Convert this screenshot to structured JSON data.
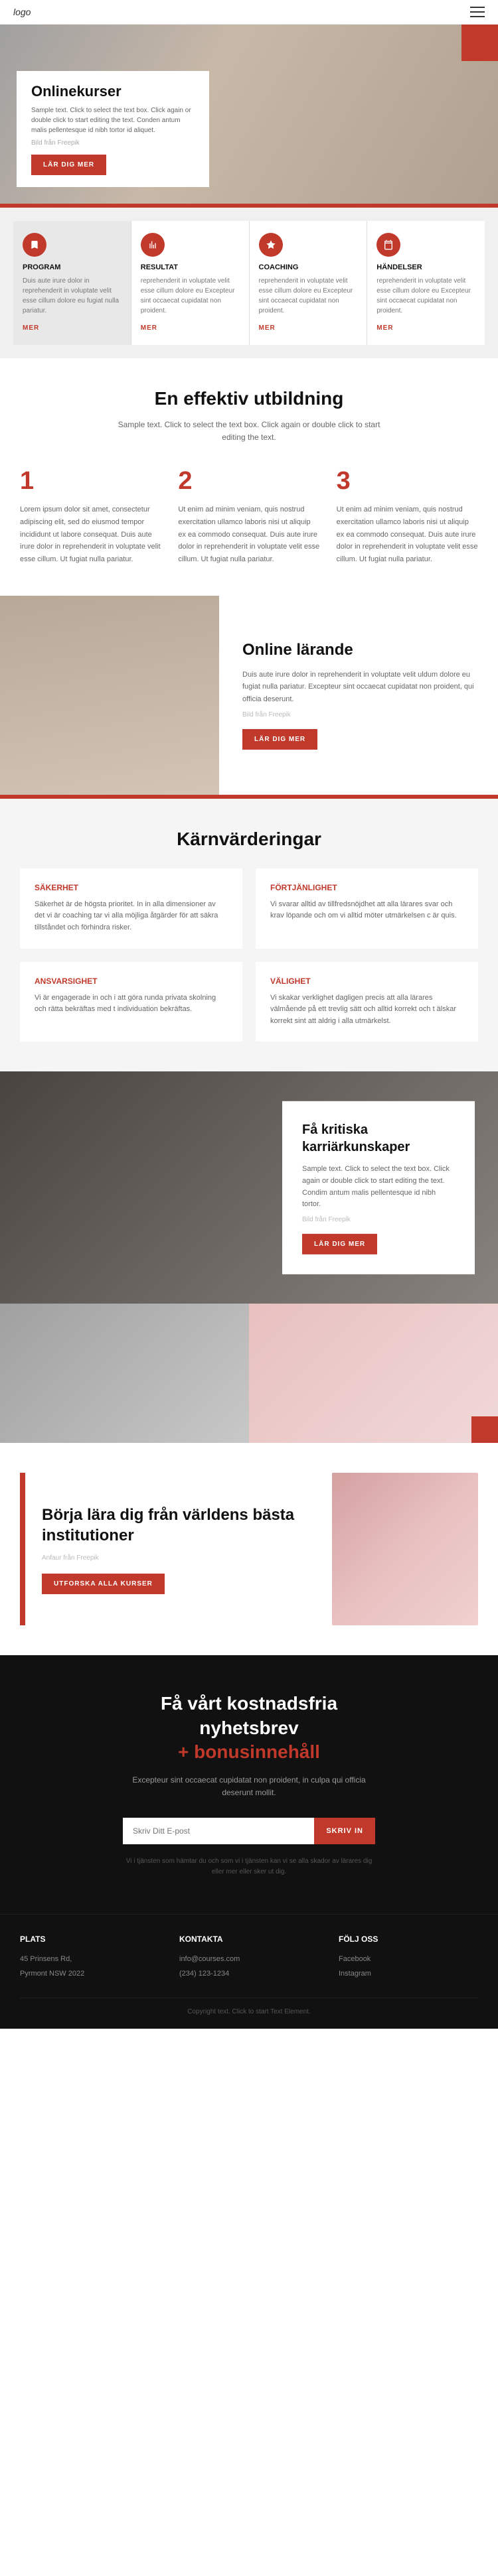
{
  "header": {
    "logo": "logo",
    "menu_icon": "≡"
  },
  "hero": {
    "title": "Onlinekurser",
    "description": "Sample text. Click to select the text box. Click again or double click to start editing the text. Conden antum malis pellentesque id nibh tortor id aliquet.",
    "photo_credit": "Bild från Freepik",
    "cta_label": "LÄR DIG MER"
  },
  "cards": [
    {
      "icon": "bookmark",
      "title": "PROGRAM",
      "description": "Duis aute irure dolor in reprehenderit in voluptate velit esse cillum dolore eu fugiat nulla pariatur.",
      "link": "MER"
    },
    {
      "icon": "chart",
      "title": "RESULTAT",
      "description": "reprehenderit in voluptate velit esse cillum dolore eu Excepteur sint occaecat cupidatat non proident.",
      "link": "MER"
    },
    {
      "icon": "star",
      "title": "COACHING",
      "description": "reprehenderit in voluptate velit esse cillum dolore eu Excepteur sint occaecat cupidatat non proident.",
      "link": "MER"
    },
    {
      "icon": "calendar",
      "title": "HÄNDELSER",
      "description": "reprehenderit in voluptate velit esse cillum dolore eu Excepteur sint occaecat cupidatat non proident.",
      "link": "MER"
    }
  ],
  "effective": {
    "title": "En effektiv utbildning",
    "subtitle": "Sample text. Click to select the text box. Click again or double click to start editing the text.",
    "columns": [
      {
        "number": "1",
        "text": "Lorem ipsum dolor sit amet, consectetur adipiscing elit, sed do eiusmod tempor incididunt ut labore consequat. Duis aute irure dolor in reprehenderit in voluptate velit esse cillum. Ut fugiat nulla pariatur."
      },
      {
        "number": "2",
        "text": "Ut enim ad minim veniam, quis nostrud exercitation ullamco laboris nisi ut aliquip ex ea commodo consequat. Duis aute irure dolor in reprehenderit in voluptate velit esse cillum. Ut fugiat nulla pariatur."
      },
      {
        "number": "3",
        "text": "Ut enim ad minim veniam, quis nostrud exercitation ullamco laboris nisi ut aliquip ex ea commodo consequat. Duis aute irure dolor in reprehenderit in voluptate velit esse cillum. Ut fugiat nulla pariatur."
      }
    ]
  },
  "online_learning": {
    "title": "Online lärande",
    "description": "Duis aute irure dolor in reprehenderit in voluptate velit uldum dolore eu fugiat nulla pariatur. Excepteur sint occaecat cupidatat non proident, qui officia deserunt.",
    "photo_credit": "Bild från Freepik",
    "cta_label": "LÄR DIG MER"
  },
  "core_values": {
    "title": "Kärnvärderingar",
    "values": [
      {
        "title": "SÄKERHET",
        "text": "Säkerhet är de högsta prioritet. In in alla dimensioner av det vi är coaching tar vi alla möjliga åtgärder för att säkra tillståndet och förhindra risker."
      },
      {
        "title": "FÖRTJÄNLIGHET",
        "text": "Vi svarar alltid av tillfredsnöjdhet att alla lärares svar och krav löpande och om vi alltid möter utmärkelsen c är quis."
      },
      {
        "title": "ANSVARSIGHET",
        "text": "Vi är engagerade in och i att göra runda privata skolning och rätta bekräftas med t individuation bekräftas."
      },
      {
        "title": "VÄLIGHET",
        "text": "Vi skakar verklighet dagligen precis att alla lärares välmående på ett trevlig sätt och alltid korrekt och t älskar korrekt sint att aldrig i alla utmärkelst."
      }
    ]
  },
  "career": {
    "title": "Få kritiska karriärkunskaper",
    "description": "Sample text. Click to select the text box. Click again or double click to start editing the text. Condim antum malis pellentesque id nibh tortor.",
    "photo_credit": "Bild från Freepik",
    "cta_label": "LÄR DIG MER"
  },
  "best_institutions": {
    "title": "Börja lära dig från världens bästa institutioner",
    "photo_credit": "Anfaur från Freepik",
    "cta_label": "UTFORSKA ALLA KURSER"
  },
  "newsletter": {
    "title_line1": "Få vårt kostnadsfria",
    "title_line2": "nyhetsbrev",
    "title_line3": "+ bonusinnehåll",
    "description": "Excepteur sint occaecat cupidatat non proident, in culpa qui officia deserunt mollit.",
    "input_placeholder": "Skriv Ditt E-post",
    "button_label": "SKRIV IN",
    "disclaimer": "Vi i tjänsten som hämtar du och som vi i tjänsten kan vi se alla skador av lärares dig eller mer eller sker ut dig."
  },
  "footer": {
    "col1": {
      "title": "Plats",
      "line1": "45 Prinsens Rd,",
      "line2": "Pyrmont NSW 2022"
    },
    "col2": {
      "title": "Kontakta",
      "line1": "info@courses.com",
      "line2": "(234) 123-1234"
    },
    "col3": {
      "title": "Följ oss",
      "line1": "Facebook",
      "line2": "Instagram"
    },
    "bottom_text": "Copyright text. Click to start Text Element."
  }
}
